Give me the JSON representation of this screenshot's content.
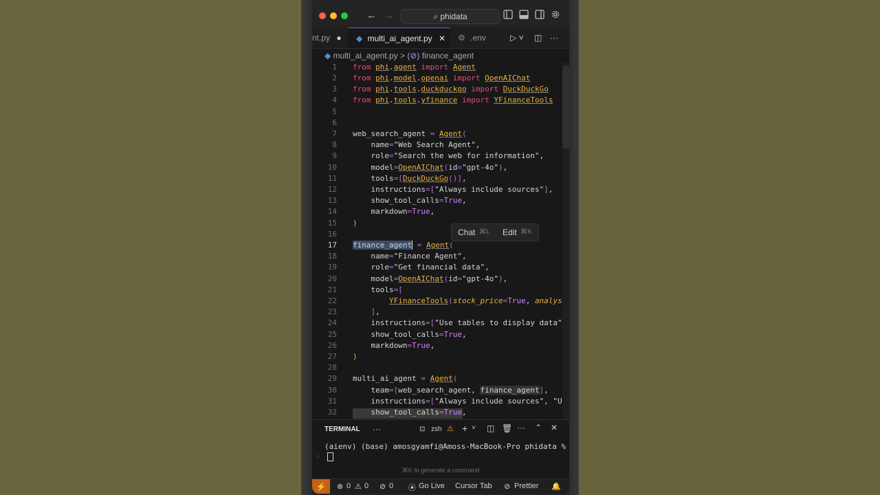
{
  "titlebar": {
    "search": "phidata"
  },
  "tabs": [
    {
      "label": "nt.py"
    },
    {
      "label": "multi_ai_agent.py"
    },
    {
      "label": ".env"
    }
  ],
  "breadcrumb": {
    "file": "multi_ai_agent.py",
    "sep": ">",
    "symbol": "finance_agent"
  },
  "editor": {
    "line_numbers": [
      "1",
      "2",
      "3",
      "4",
      "5",
      "6",
      "7",
      "8",
      "9",
      "10",
      "11",
      "12",
      "13",
      "14",
      "15",
      "16",
      "17",
      "18",
      "19",
      "20",
      "21",
      "22",
      "23",
      "24",
      "25",
      "26",
      "27",
      "28",
      "29",
      "30",
      "31",
      "32"
    ]
  },
  "popup": {
    "chat": "Chat",
    "chat_kb": "⌘L",
    "edit": "Edit",
    "edit_kb": "⌘K"
  },
  "terminal": {
    "tab": "TERMINAL",
    "shell": "zsh",
    "prompt": "(aienv) (base) amosgyamfi@Amoss-MacBook-Pro phidata %",
    "hint": "⌘K to generate a command"
  },
  "status": {
    "errors": "0",
    "warnings": "0",
    "ports": "0",
    "golive": "Go Live",
    "cursortab": "Cursor Tab",
    "prettier": "Prettier"
  },
  "colors": {
    "accent": "#3a77c9",
    "remote": "#c4621a",
    "keyword": "#e8487d",
    "module": "#e8b13d",
    "constant": "#d081ff"
  }
}
